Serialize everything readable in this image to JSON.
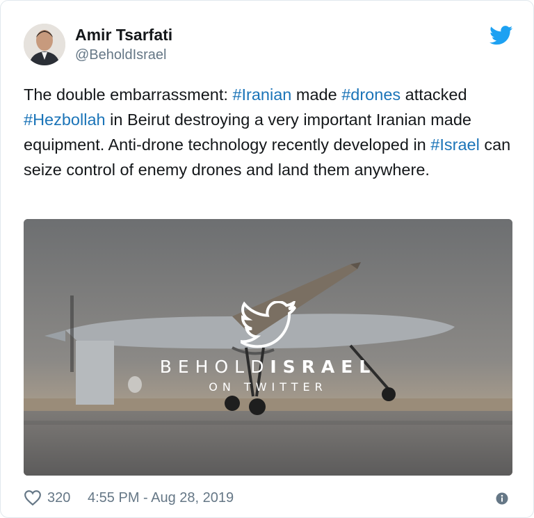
{
  "tweet": {
    "author_name": "Amir Tsarfati",
    "author_handle": "@BeholdIsrael",
    "text_parts": [
      {
        "type": "text",
        "value": "The double embarrassment: "
      },
      {
        "type": "hashtag",
        "value": "#Iranian"
      },
      {
        "type": "text",
        "value": " made "
      },
      {
        "type": "hashtag",
        "value": "#drones"
      },
      {
        "type": "text",
        "value": " attacked "
      },
      {
        "type": "hashtag",
        "value": "#Hezbollah"
      },
      {
        "type": "text",
        "value": " in Beirut destroying a very important Iranian made equipment. Anti-drone technology recently developed in "
      },
      {
        "type": "hashtag",
        "value": "#Israel"
      },
      {
        "type": "text",
        "value": " can seize control of enemy drones and land them anywhere."
      }
    ],
    "media": {
      "brand_light": "BEHOLD",
      "brand_bold": "ISRAEL",
      "brand_sub": "ON TWITTER"
    },
    "likes": "320",
    "timestamp": "4:55 PM - Aug 28, 2019"
  },
  "colors": {
    "hashtag": "#1b74b8",
    "twitter_blue": "#1da1f2",
    "meta": "#657786"
  },
  "icons": {
    "logo": "twitter-bird-icon",
    "like": "heart-icon",
    "info": "info-icon"
  }
}
